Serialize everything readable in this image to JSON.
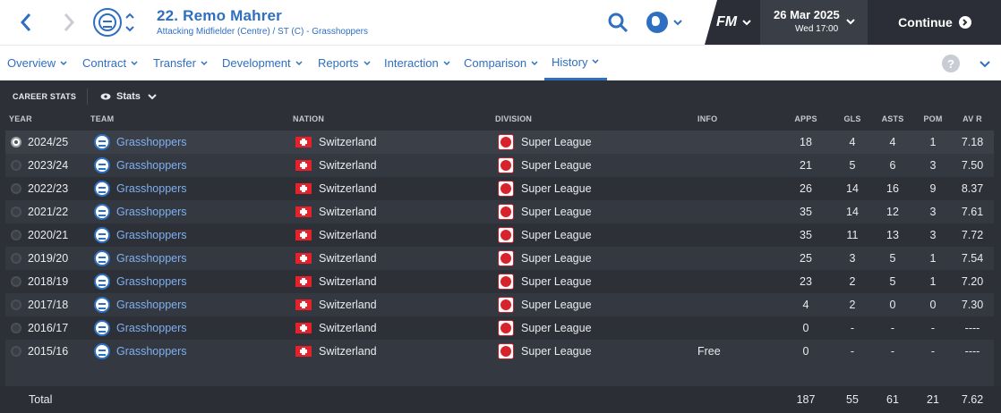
{
  "header": {
    "player_title": "22. Remo Mahrer",
    "player_subtitle": "Attacking Midfielder (Centre) / ST (C) - Grasshoppers",
    "brand": "FM",
    "date": "26 Mar 2025",
    "day_time": "Wed 17:00",
    "continue_label": "Continue"
  },
  "tabs": [
    {
      "label": "Overview"
    },
    {
      "label": "Contract"
    },
    {
      "label": "Transfer"
    },
    {
      "label": "Development"
    },
    {
      "label": "Reports"
    },
    {
      "label": "Interaction"
    },
    {
      "label": "Comparison"
    },
    {
      "label": "History",
      "active": true
    }
  ],
  "help_label": "?",
  "panel": {
    "title": "CAREER STATS",
    "view_selector": "Stats"
  },
  "columns": {
    "year": "YEAR",
    "team": "TEAM",
    "nation": "NATION",
    "division": "DIVISION",
    "info": "INFO",
    "apps": "APPS",
    "gls": "GLS",
    "asts": "ASTS",
    "pom": "POM",
    "avr": "AV R"
  },
  "rows": [
    {
      "year": "2024/25",
      "team": "Grasshoppers",
      "nation": "Switzerland",
      "division": "Super League",
      "info": "",
      "apps": "18",
      "gls": "4",
      "asts": "4",
      "pom": "1",
      "avr": "7.18"
    },
    {
      "year": "2023/24",
      "team": "Grasshoppers",
      "nation": "Switzerland",
      "division": "Super League",
      "info": "",
      "apps": "21",
      "gls": "5",
      "asts": "6",
      "pom": "3",
      "avr": "7.50"
    },
    {
      "year": "2022/23",
      "team": "Grasshoppers",
      "nation": "Switzerland",
      "division": "Super League",
      "info": "",
      "apps": "26",
      "gls": "14",
      "asts": "16",
      "pom": "9",
      "avr": "8.37"
    },
    {
      "year": "2021/22",
      "team": "Grasshoppers",
      "nation": "Switzerland",
      "division": "Super League",
      "info": "",
      "apps": "35",
      "gls": "14",
      "asts": "12",
      "pom": "3",
      "avr": "7.61"
    },
    {
      "year": "2020/21",
      "team": "Grasshoppers",
      "nation": "Switzerland",
      "division": "Super League",
      "info": "",
      "apps": "35",
      "gls": "11",
      "asts": "13",
      "pom": "3",
      "avr": "7.72"
    },
    {
      "year": "2019/20",
      "team": "Grasshoppers",
      "nation": "Switzerland",
      "division": "Super League",
      "info": "",
      "apps": "25",
      "gls": "3",
      "asts": "5",
      "pom": "1",
      "avr": "7.54"
    },
    {
      "year": "2018/19",
      "team": "Grasshoppers",
      "nation": "Switzerland",
      "division": "Super League",
      "info": "",
      "apps": "23",
      "gls": "2",
      "asts": "5",
      "pom": "1",
      "avr": "7.20"
    },
    {
      "year": "2017/18",
      "team": "Grasshoppers",
      "nation": "Switzerland",
      "division": "Super League",
      "info": "",
      "apps": "4",
      "gls": "2",
      "asts": "0",
      "pom": "0",
      "avr": "7.30"
    },
    {
      "year": "2016/17",
      "team": "Grasshoppers",
      "nation": "Switzerland",
      "division": "Super League",
      "info": "",
      "apps": "0",
      "gls": "-",
      "asts": "-",
      "pom": "-",
      "avr": "----"
    },
    {
      "year": "2015/16",
      "team": "Grasshoppers",
      "nation": "Switzerland",
      "division": "Super League",
      "info": "Free",
      "apps": "0",
      "gls": "-",
      "asts": "-",
      "pom": "-",
      "avr": "----"
    }
  ],
  "totals": {
    "label": "Total",
    "apps": "187",
    "gls": "55",
    "asts": "61",
    "pom": "21",
    "avr": "7.62"
  },
  "colors": {
    "accent": "#2f6fc0",
    "link": "#7fb0f0",
    "panel_bg": "#2d3037",
    "header_dark": "#2b2e36"
  }
}
